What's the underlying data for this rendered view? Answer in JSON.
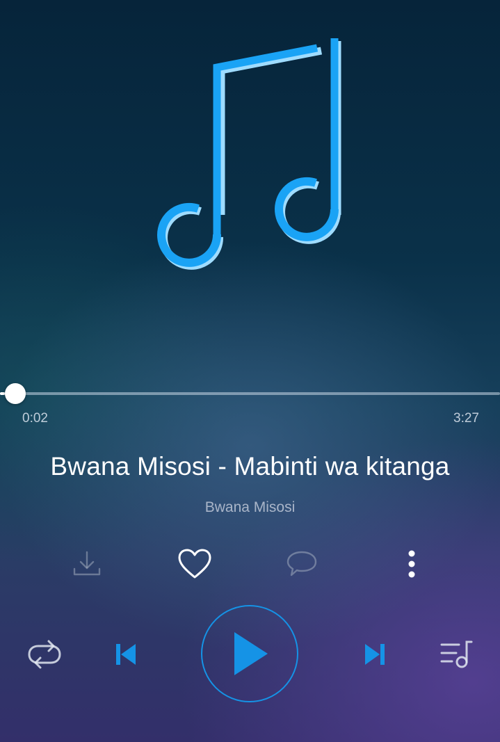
{
  "player": {
    "elapsed": "0:02",
    "duration": "3:27",
    "progress_fraction": 0.01,
    "title": "Bwana Misosi - Mabinti wa kitanga",
    "artist": "Bwana Misosi"
  },
  "actions": [
    {
      "icon": "download-icon",
      "enabled": false
    },
    {
      "icon": "heart-icon",
      "enabled": true
    },
    {
      "icon": "comment-icon",
      "enabled": false
    },
    {
      "icon": "more-vertical-icon",
      "enabled": true
    }
  ],
  "controls": {
    "repeat": "repeat-icon",
    "previous": "skip-previous-icon",
    "play": "play-icon",
    "next": "skip-next-icon",
    "queue": "playlist-icon"
  },
  "colors": {
    "accent": "#1593e6",
    "note": "#1aa3f5",
    "note_highlight": "#9fdcff"
  }
}
